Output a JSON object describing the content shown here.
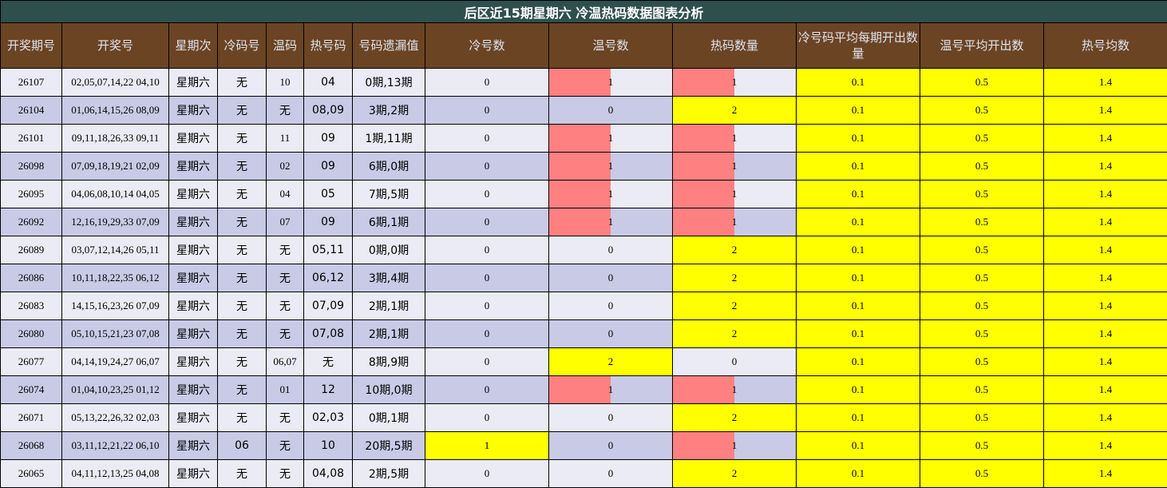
{
  "title": "后区近15期星期六 冷温热码数据图表分析",
  "headers": [
    "开奖期号",
    "开奖号",
    "星期次",
    "冷码号",
    "温码",
    "热号码",
    "号码遗漏值",
    "冷号数",
    "温号数",
    "热码数量",
    "冷号码平均每期开出数量",
    "温号平均开出数",
    "热号均数"
  ],
  "colors": {
    "title_bg": "#2f4f4f",
    "header_bg": "#6b4423",
    "row_light": "#ebebf5",
    "row_dark": "#c8cae6",
    "highlight": "#ffff00",
    "bar": "#ff8080"
  },
  "chart_data": {
    "type": "table",
    "rows": [
      {
        "issue": "26107",
        "numbers": "02,05,07,14,22 04,10",
        "weekday": "星期六",
        "cold": "无",
        "warm": "10",
        "hot": "04",
        "omission": "0期,13期",
        "cold_count": 0,
        "warm_count": 1,
        "hot_count": 1,
        "cold_avg": "0.1",
        "warm_avg": "0.5",
        "hot_avg": "1.4"
      },
      {
        "issue": "26104",
        "numbers": "01,06,14,15,26 08,09",
        "weekday": "星期六",
        "cold": "无",
        "warm": "无",
        "hot": "08,09",
        "omission": "3期,2期",
        "cold_count": 0,
        "warm_count": 0,
        "hot_count": 2,
        "cold_avg": "0.1",
        "warm_avg": "0.5",
        "hot_avg": "1.4"
      },
      {
        "issue": "26101",
        "numbers": "09,11,18,26,33 09,11",
        "weekday": "星期六",
        "cold": "无",
        "warm": "11",
        "hot": "09",
        "omission": "1期,11期",
        "cold_count": 0,
        "warm_count": 1,
        "hot_count": 1,
        "cold_avg": "0.1",
        "warm_avg": "0.5",
        "hot_avg": "1.4"
      },
      {
        "issue": "26098",
        "numbers": "07,09,18,19,21 02,09",
        "weekday": "星期六",
        "cold": "无",
        "warm": "02",
        "hot": "09",
        "omission": "6期,0期",
        "cold_count": 0,
        "warm_count": 1,
        "hot_count": 1,
        "cold_avg": "0.1",
        "warm_avg": "0.5",
        "hot_avg": "1.4"
      },
      {
        "issue": "26095",
        "numbers": "04,06,08,10,14 04,05",
        "weekday": "星期六",
        "cold": "无",
        "warm": "04",
        "hot": "05",
        "omission": "7期,5期",
        "cold_count": 0,
        "warm_count": 1,
        "hot_count": 1,
        "cold_avg": "0.1",
        "warm_avg": "0.5",
        "hot_avg": "1.4"
      },
      {
        "issue": "26092",
        "numbers": "12,16,19,29,33 07,09",
        "weekday": "星期六",
        "cold": "无",
        "warm": "07",
        "hot": "09",
        "omission": "6期,1期",
        "cold_count": 0,
        "warm_count": 1,
        "hot_count": 1,
        "cold_avg": "0.1",
        "warm_avg": "0.5",
        "hot_avg": "1.4"
      },
      {
        "issue": "26089",
        "numbers": "03,07,12,14,26 05,11",
        "weekday": "星期六",
        "cold": "无",
        "warm": "无",
        "hot": "05,11",
        "omission": "0期,0期",
        "cold_count": 0,
        "warm_count": 0,
        "hot_count": 2,
        "cold_avg": "0.1",
        "warm_avg": "0.5",
        "hot_avg": "1.4"
      },
      {
        "issue": "26086",
        "numbers": "10,11,18,22,35 06,12",
        "weekday": "星期六",
        "cold": "无",
        "warm": "无",
        "hot": "06,12",
        "omission": "3期,4期",
        "cold_count": 0,
        "warm_count": 0,
        "hot_count": 2,
        "cold_avg": "0.1",
        "warm_avg": "0.5",
        "hot_avg": "1.4"
      },
      {
        "issue": "26083",
        "numbers": "14,15,16,23,26 07,09",
        "weekday": "星期六",
        "cold": "无",
        "warm": "无",
        "hot": "07,09",
        "omission": "2期,1期",
        "cold_count": 0,
        "warm_count": 0,
        "hot_count": 2,
        "cold_avg": "0.1",
        "warm_avg": "0.5",
        "hot_avg": "1.4"
      },
      {
        "issue": "26080",
        "numbers": "05,10,15,21,23 07,08",
        "weekday": "星期六",
        "cold": "无",
        "warm": "无",
        "hot": "07,08",
        "omission": "2期,1期",
        "cold_count": 0,
        "warm_count": 0,
        "hot_count": 2,
        "cold_avg": "0.1",
        "warm_avg": "0.5",
        "hot_avg": "1.4"
      },
      {
        "issue": "26077",
        "numbers": "04,14,19,24,27 06,07",
        "weekday": "星期六",
        "cold": "无",
        "warm": "06,07",
        "hot": "无",
        "omission": "8期,9期",
        "cold_count": 0,
        "warm_count": 2,
        "hot_count": 0,
        "cold_avg": "0.1",
        "warm_avg": "0.5",
        "hot_avg": "1.4"
      },
      {
        "issue": "26074",
        "numbers": "01,04,10,23,25 01,12",
        "weekday": "星期六",
        "cold": "无",
        "warm": "01",
        "hot": "12",
        "omission": "10期,0期",
        "cold_count": 0,
        "warm_count": 1,
        "hot_count": 1,
        "cold_avg": "0.1",
        "warm_avg": "0.5",
        "hot_avg": "1.4"
      },
      {
        "issue": "26071",
        "numbers": "05,13,22,26,32 02,03",
        "weekday": "星期六",
        "cold": "无",
        "warm": "无",
        "hot": "02,03",
        "omission": "0期,1期",
        "cold_count": 0,
        "warm_count": 0,
        "hot_count": 2,
        "cold_avg": "0.1",
        "warm_avg": "0.5",
        "hot_avg": "1.4"
      },
      {
        "issue": "26068",
        "numbers": "03,11,12,21,22 06,10",
        "weekday": "星期六",
        "cold": "06",
        "warm": "无",
        "hot": "10",
        "omission": "20期,5期",
        "cold_count": 1,
        "warm_count": 0,
        "hot_count": 1,
        "cold_avg": "0.1",
        "warm_avg": "0.5",
        "hot_avg": "1.4"
      },
      {
        "issue": "26065",
        "numbers": "04,11,12,13,25 04,08",
        "weekday": "星期六",
        "cold": "无",
        "warm": "无",
        "hot": "04,08",
        "omission": "2期,5期",
        "cold_count": 0,
        "warm_count": 0,
        "hot_count": 2,
        "cold_avg": "0.1",
        "warm_avg": "0.5",
        "hot_avg": "1.4"
      }
    ]
  }
}
